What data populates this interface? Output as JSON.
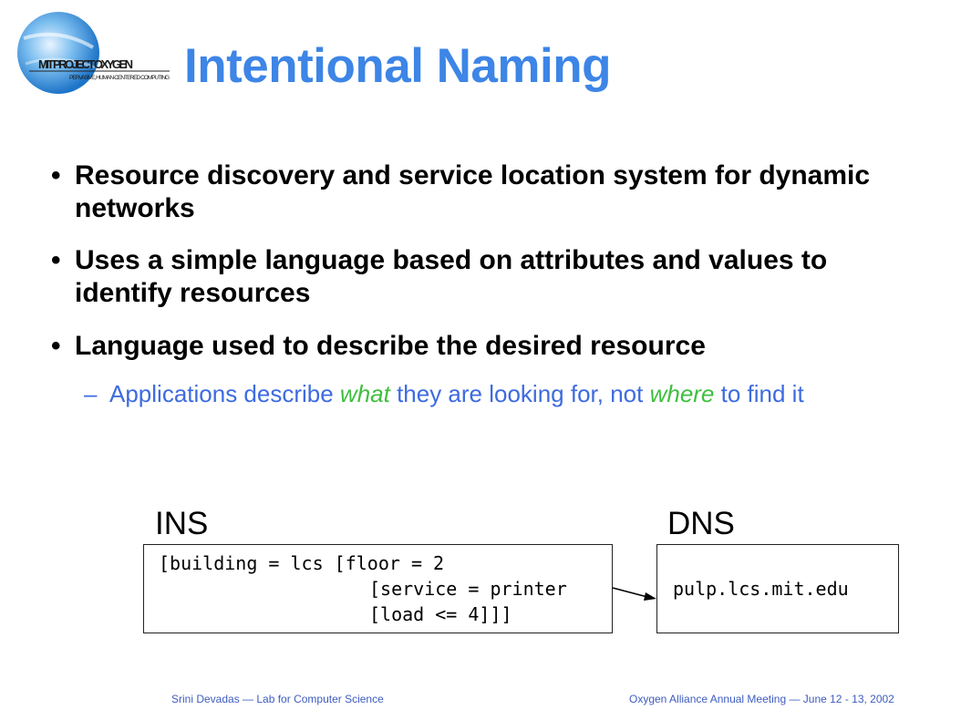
{
  "logo": {
    "main_text": "MIT PROJECT OXYGEN",
    "sub_text": "PERVASIVE, HUMAN-CENTERED COMPUTING"
  },
  "title": "Intentional Naming",
  "bullets": [
    {
      "marker": "•",
      "text": "Resource discovery and service location system for dynamic networks"
    },
    {
      "marker": "•",
      "text": "Uses a simple language based on attributes and values to identify resources"
    },
    {
      "marker": "•",
      "text": "Language used to describe the desired resource"
    }
  ],
  "subbullet": {
    "marker": "–",
    "part1": "Applications describe ",
    "em1": "what",
    "part2": " they are looking for, not ",
    "em2": "where",
    "part3": " to find it"
  },
  "ins": {
    "label": "INS",
    "lines": [
      "[building = lcs [floor = 2",
      "[service = printer",
      "[load <= 4]]]"
    ]
  },
  "dns": {
    "label": "DNS",
    "value": "pulp.lcs.mit.edu"
  },
  "footer": {
    "left": "Srini Devadas —  Lab for Computer Science",
    "right": "Oxygen Alliance Annual Meeting — June 12 - 13, 2002"
  },
  "colors": {
    "title": "#3D85E6",
    "subtext": "#3D6BE0",
    "emphasis": "#3FBF3F"
  }
}
